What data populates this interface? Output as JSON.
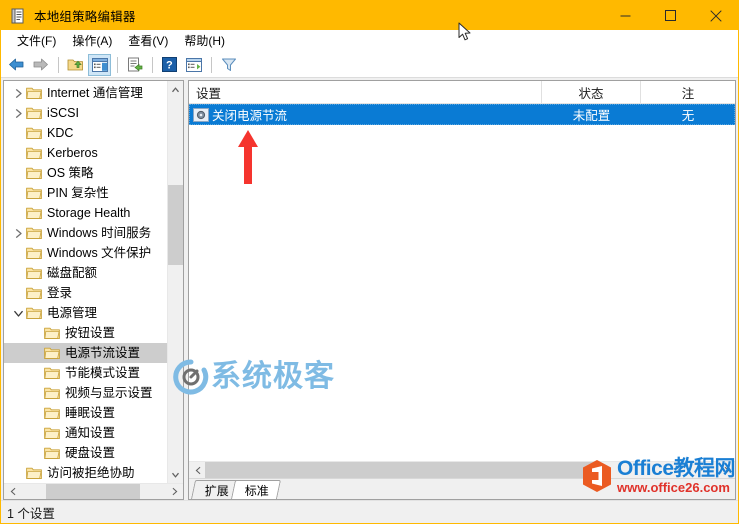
{
  "window": {
    "title": "本地组策略编辑器",
    "icon": "policy-editor-icon",
    "titlebar_color": "#ffb900",
    "minimize_label": "最小化",
    "maximize_label": "最大化",
    "close_label": "关闭"
  },
  "menu": {
    "items": [
      {
        "label": "文件(F)",
        "name": "menu-file"
      },
      {
        "label": "操作(A)",
        "name": "menu-action"
      },
      {
        "label": "查看(V)",
        "name": "menu-view"
      },
      {
        "label": "帮助(H)",
        "name": "menu-help"
      }
    ]
  },
  "toolbar": {
    "items": [
      {
        "name": "back-icon",
        "label": "后退"
      },
      {
        "name": "forward-icon",
        "label": "前进"
      },
      {
        "name": "up-one-level-icon",
        "label": "上一级"
      },
      {
        "name": "show-hide-tree-icon",
        "label": "显示/隐藏控制台树",
        "pressed": true
      },
      {
        "name": "export-list-icon",
        "label": "导出列表"
      },
      {
        "name": "help-icon",
        "label": "帮助"
      },
      {
        "name": "show-action-pane-icon",
        "label": "显示/隐藏操作窗格"
      },
      {
        "name": "filter-icon",
        "label": "筛选器"
      }
    ]
  },
  "tree": {
    "items": [
      {
        "label": "Internet 通信管理",
        "chevron": "collapsed",
        "indent": 0,
        "selected": false
      },
      {
        "label": "iSCSI",
        "chevron": "collapsed",
        "indent": 0,
        "selected": false
      },
      {
        "label": "KDC",
        "chevron": "none",
        "indent": 0,
        "selected": false
      },
      {
        "label": "Kerberos",
        "chevron": "none",
        "indent": 0,
        "selected": false
      },
      {
        "label": "OS 策略",
        "chevron": "none",
        "indent": 0,
        "selected": false
      },
      {
        "label": "PIN 复杂性",
        "chevron": "none",
        "indent": 0,
        "selected": false
      },
      {
        "label": "Storage Health",
        "chevron": "none",
        "indent": 0,
        "selected": false
      },
      {
        "label": "Windows 时间服务",
        "chevron": "collapsed",
        "indent": 0,
        "selected": false
      },
      {
        "label": "Windows 文件保护",
        "chevron": "none",
        "indent": 0,
        "selected": false
      },
      {
        "label": "磁盘配额",
        "chevron": "none",
        "indent": 0,
        "selected": false
      },
      {
        "label": "登录",
        "chevron": "none",
        "indent": 0,
        "selected": false
      },
      {
        "label": "电源管理",
        "chevron": "expanded",
        "indent": 0,
        "selected": false
      },
      {
        "label": "按钮设置",
        "chevron": "none",
        "indent": 1,
        "selected": false
      },
      {
        "label": "电源节流设置",
        "chevron": "none",
        "indent": 1,
        "selected": true
      },
      {
        "label": "节能模式设置",
        "chevron": "none",
        "indent": 1,
        "selected": false
      },
      {
        "label": "视频与显示设置",
        "chevron": "none",
        "indent": 1,
        "selected": false
      },
      {
        "label": "睡眠设置",
        "chevron": "none",
        "indent": 1,
        "selected": false
      },
      {
        "label": "通知设置",
        "chevron": "none",
        "indent": 1,
        "selected": false
      },
      {
        "label": "硬盘设置",
        "chevron": "none",
        "indent": 1,
        "selected": false
      },
      {
        "label": "访问被拒绝协助",
        "chevron": "none",
        "indent": 0,
        "selected": false
      }
    ]
  },
  "list": {
    "columns": [
      {
        "label": "设置",
        "name": "column-setting"
      },
      {
        "label": "状态",
        "name": "column-state"
      },
      {
        "label": "注",
        "name": "column-comment"
      }
    ],
    "rows": [
      {
        "setting": "关闭电源节流",
        "state": "未配置",
        "comment": "无",
        "icon": "policy-setting-icon",
        "selected": true
      }
    ]
  },
  "tabs": [
    {
      "label": "扩展",
      "name": "tab-extended",
      "active": false
    },
    {
      "label": "标准",
      "name": "tab-standard",
      "active": true
    }
  ],
  "statusbar": {
    "text": "1 个设置"
  },
  "annotations": {
    "red_arrow": {
      "name": "red-arrow-annotation",
      "color": "#f5342e"
    }
  },
  "watermarks": {
    "geek": {
      "text": "系统极客",
      "color": "#7fbbe4"
    },
    "office": {
      "line1": "Office教程网",
      "line2": "www.office26.com",
      "color1": "#1a7fd4",
      "color2": "#e0322a"
    }
  }
}
